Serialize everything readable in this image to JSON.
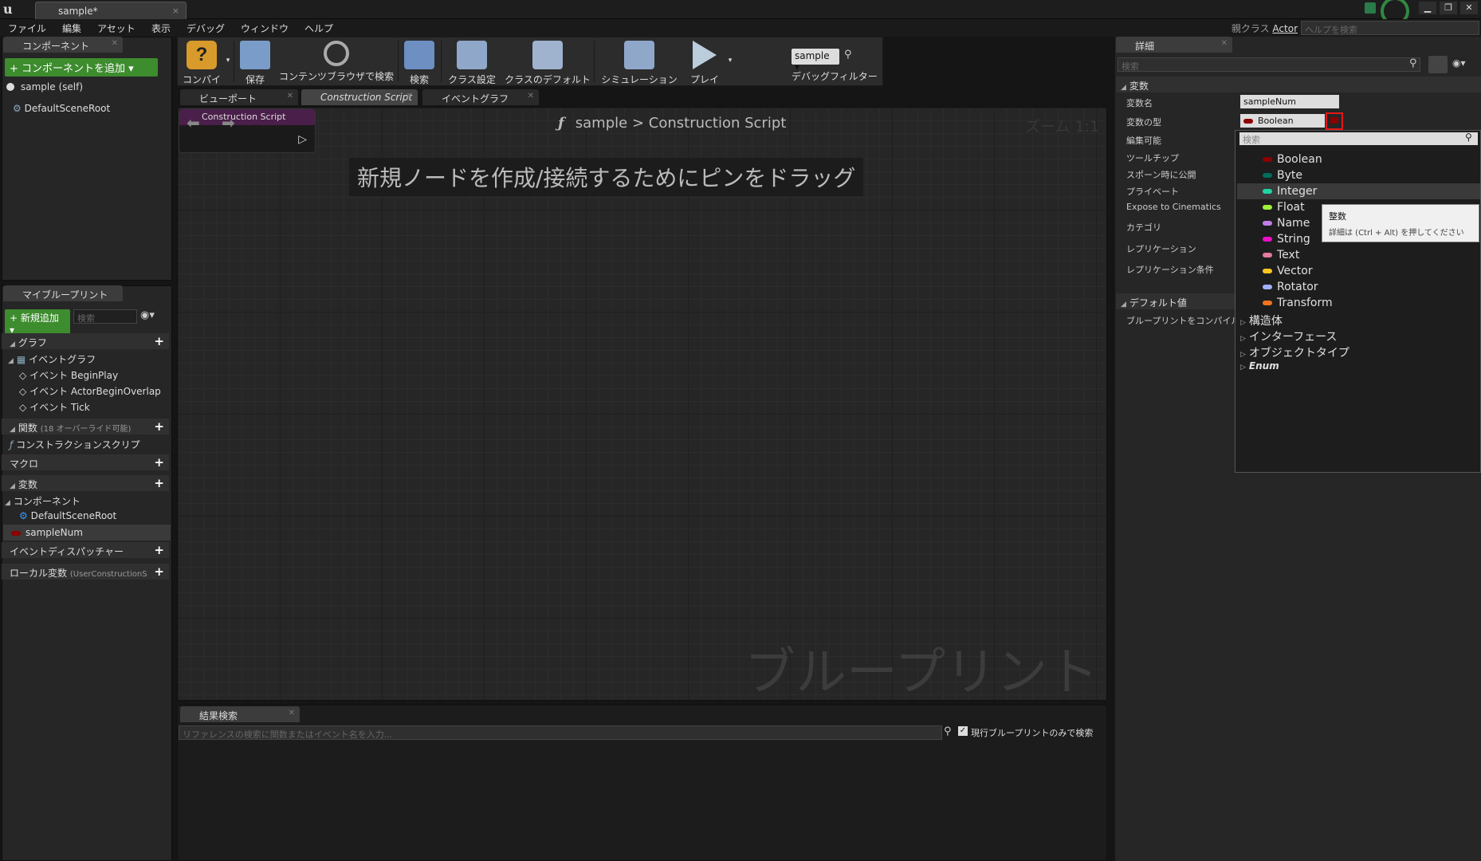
{
  "titlebar": {
    "logo": "u",
    "tab": "sample*",
    "close": "×",
    "win": [
      "▁",
      "❐",
      "✕"
    ]
  },
  "menu": [
    "ファイル",
    "編集",
    "アセット",
    "表示",
    "デバッグ",
    "ウィンドウ",
    "ヘルプ"
  ],
  "parent_class": {
    "label": "親クラス",
    "value": "Actor"
  },
  "help_search": {
    "placeholder": "ヘルプを検索"
  },
  "components": {
    "tab": "コンポーネント",
    "add_button": "+ コンポーネントを追加 ▾",
    "items": [
      "sample (self)",
      "DefaultSceneRoot"
    ]
  },
  "myblueprint": {
    "tab": "マイブループリント",
    "new_button": "+ 新規追加 ▾",
    "search_placeholder": "検索",
    "graph_header": "グラフ",
    "event_graph": "イベントグラフ",
    "events": [
      "イベント BeginPlay",
      "イベント ActorBeginOverlap",
      "イベント Tick"
    ],
    "functions_header": "関数",
    "functions_note": "(18 オーバーライド可能)",
    "construction": "コンストラクションスクリプ",
    "macro_header": "マクロ",
    "variables_header": "変数",
    "comp_header": "コンポーネント",
    "comp_item": "DefaultSceneRoot",
    "var_item": "sampleNum",
    "dispatchers": "イベントディスパッチャー",
    "locals": "ローカル変数",
    "locals_note": "(UserConstructionS"
  },
  "toolbar": {
    "buttons": [
      "コンパイル",
      "保存",
      "コンテンツブラウザで検索",
      "検索",
      "クラス設定",
      "クラスのデフォルト",
      "シミュレーション",
      "プレイ"
    ],
    "debug_select": "sample ▾",
    "debug_label": "デバッグフィルター"
  },
  "editor_tabs": [
    "ビューポート",
    "Construction Script",
    "イベントグラフ"
  ],
  "graph": {
    "func_node": "Construction Script",
    "breadcrumb_root": "sample",
    "breadcrumb_sep": ">",
    "breadcrumb_leaf": "Construction Script",
    "zoom": "ズーム 1:1",
    "hint": "新規ノードを作成/接続するためにピンをドラッグ",
    "watermark": "ブループリント"
  },
  "find_results": {
    "tab": "結果検索",
    "placeholder": "リファレンスの検索に関数またはイベント名を入力...",
    "checkbox": "現行ブループリントのみで検索"
  },
  "details": {
    "tab": "詳細",
    "search_placeholder": "検索",
    "section_vars": "変数",
    "labels": [
      "変数名",
      "変数の型",
      "編集可能",
      "ツールチップ",
      "スポーン時に公開",
      "プライベート",
      "Expose to Cinematics",
      "カテゴリ",
      "レプリケーション",
      "レプリケーション条件"
    ],
    "var_name": "sampleNum",
    "var_type": "Boolean",
    "section_default": "デフォルト値",
    "default_note": "ブループリントをコンパイル"
  },
  "type_menu": {
    "search_placeholder": "検索",
    "items": [
      {
        "label": "Boolean",
        "color": "#8c0000"
      },
      {
        "label": "Byte",
        "color": "#006c5b"
      },
      {
        "label": "Integer",
        "color": "#1ed6a4"
      },
      {
        "label": "Float",
        "color": "#9ff03a"
      },
      {
        "label": "Name",
        "color": "#c27ee6"
      },
      {
        "label": "String",
        "color": "#f00ec6"
      },
      {
        "label": "Text",
        "color": "#e37ba0"
      },
      {
        "label": "Vector",
        "color": "#fdc521"
      },
      {
        "label": "Rotator",
        "color": "#9fb0fd"
      },
      {
        "label": "Transform",
        "color": "#f07320"
      }
    ],
    "groups": [
      "構造体",
      "インターフェース",
      "オブジェクトタイプ",
      "Enum"
    ]
  },
  "tooltip": {
    "title": "整数",
    "body": "詳細は (Ctrl + Alt) を押してください"
  }
}
